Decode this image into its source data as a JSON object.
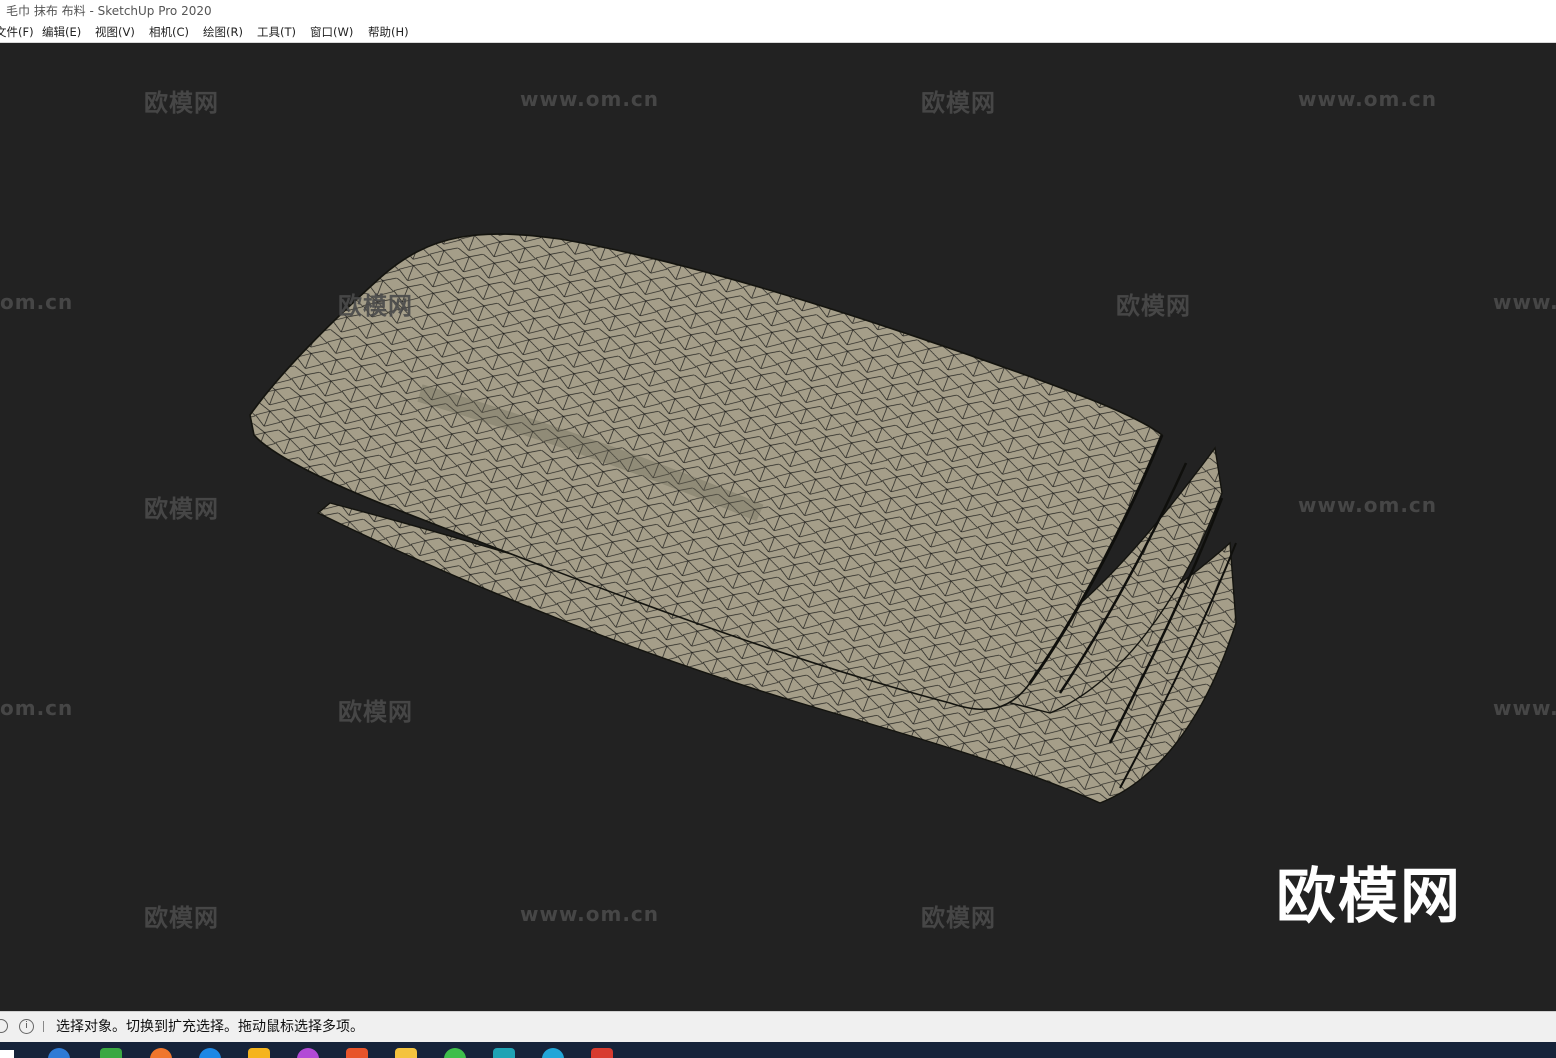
{
  "window": {
    "title": "毛巾 抹布 布料 - SketchUp Pro 2020"
  },
  "menu": {
    "items": [
      {
        "label": "文件(F)"
      },
      {
        "label": "编辑(E)"
      },
      {
        "label": "视图(V)"
      },
      {
        "label": "相机(C)"
      },
      {
        "label": "绘图(R)"
      },
      {
        "label": "工具(T)"
      },
      {
        "label": "窗口(W)"
      },
      {
        "label": "帮助(H)"
      }
    ]
  },
  "viewport": {
    "background": "#222222",
    "model_fill": "#a59e89",
    "mesh_color": "#1a1a18",
    "watermark_cn": "欧模网",
    "watermark_en": "www.om.cn",
    "watermark_en_left_crop": "om.cn",
    "watermark_en_right_crop": "www.",
    "brand": "欧模网"
  },
  "status": {
    "text": "选择对象。切换到扩充选择。拖动鼠标选择多项。"
  },
  "taskbar": {
    "icons": [
      {
        "name": "windows-start-icon",
        "color": "#ffffff"
      },
      {
        "name": "browser-icon",
        "color": "#2e7bd6"
      },
      {
        "name": "game-icon",
        "color": "#3aa842"
      },
      {
        "name": "app-orange-icon",
        "color": "#f0762d"
      },
      {
        "name": "app-blue-icon",
        "color": "#1e88e5"
      },
      {
        "name": "media-player-icon",
        "color": "#f5b41d"
      },
      {
        "name": "app-purple-icon",
        "color": "#b24ad6"
      },
      {
        "name": "app-red-icon",
        "color": "#e8542a"
      },
      {
        "name": "folder-icon",
        "color": "#f4c33e"
      },
      {
        "name": "wechat-icon",
        "color": "#3fbe4a"
      },
      {
        "name": "app-teal-icon",
        "color": "#1fa3b4"
      },
      {
        "name": "edge-icon",
        "color": "#22a6d8"
      },
      {
        "name": "sketchup-icon",
        "color": "#d83b2f"
      }
    ]
  }
}
